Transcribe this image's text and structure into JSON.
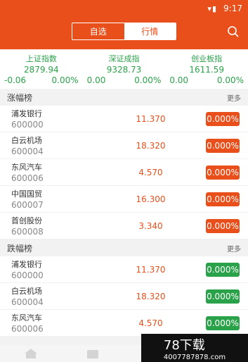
{
  "status": {
    "time": "9:17"
  },
  "header": {
    "tabs": [
      {
        "label": "自选"
      },
      {
        "label": "行情"
      }
    ],
    "active_tab": "行情"
  },
  "indices": [
    {
      "name": "上证指数",
      "value": "2879.94",
      "change": "-0.06",
      "pct": "0.00%"
    },
    {
      "name": "深证成指",
      "value": "9328.73",
      "change": "0.00",
      "pct": "0.00%"
    },
    {
      "name": "创业板指",
      "value": "1611.59",
      "change": "0.00",
      "pct": "0.00%"
    }
  ],
  "gainers": {
    "title": "涨幅榜",
    "more": "更多",
    "items": [
      {
        "name": "浦发银行",
        "code": "600000",
        "price": "11.370",
        "pct": "0.000%"
      },
      {
        "name": "白云机场",
        "code": "600004",
        "price": "18.320",
        "pct": "0.000%"
      },
      {
        "name": "东风汽车",
        "code": "600006",
        "price": "4.570",
        "pct": "0.000%"
      },
      {
        "name": "中国国贸",
        "code": "600007",
        "price": "16.300",
        "pct": "0.000%"
      },
      {
        "name": "首创股份",
        "code": "600008",
        "price": "3.340",
        "pct": "0.000%"
      }
    ]
  },
  "losers": {
    "title": "跌幅榜",
    "more": "更多",
    "items": [
      {
        "name": "浦发银行",
        "code": "600000",
        "price": "11.370",
        "pct": "0.000%"
      },
      {
        "name": "白云机场",
        "code": "600004",
        "price": "18.320",
        "pct": "0.000%"
      },
      {
        "name": "东风汽车",
        "code": "600006",
        "price": "4.570",
        "pct": "0.000%"
      }
    ]
  },
  "watermark": {
    "text": "78下载",
    "url": "4007787878.com"
  },
  "colors": {
    "brand": "#e94f1a",
    "up": "#e94f1a",
    "down": "#2aa24a"
  },
  "icons": [
    "wifi-icon",
    "signal-icon",
    "battery-icon",
    "search-icon"
  ]
}
